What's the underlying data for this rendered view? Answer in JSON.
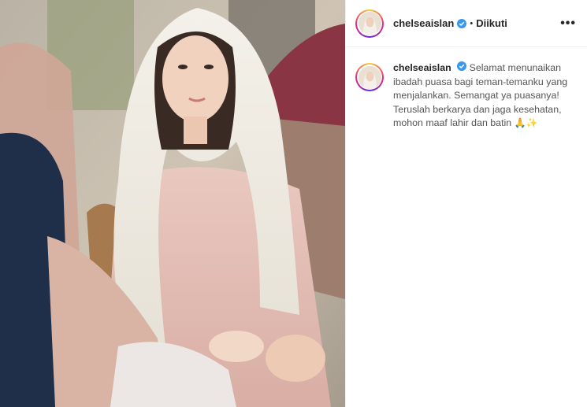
{
  "post": {
    "username": "chelseaislan",
    "follow_status": "Diikuti",
    "separator": "•",
    "more_label": "•••",
    "caption_text": "Selamat menunaikan ibadah puasa bagi teman-temanku yang menjalankan. Semangat ya puasanya! Teruslah berkarya dan jaga kesehatan, mohon maaf lahir dan batin",
    "caption_emoji": "🙏✨"
  },
  "colors": {
    "text": "#262626",
    "verified": "#3897f0",
    "border": "#efefef"
  },
  "icons": {
    "verified": "verified-badge-icon",
    "more": "more-options-icon"
  }
}
